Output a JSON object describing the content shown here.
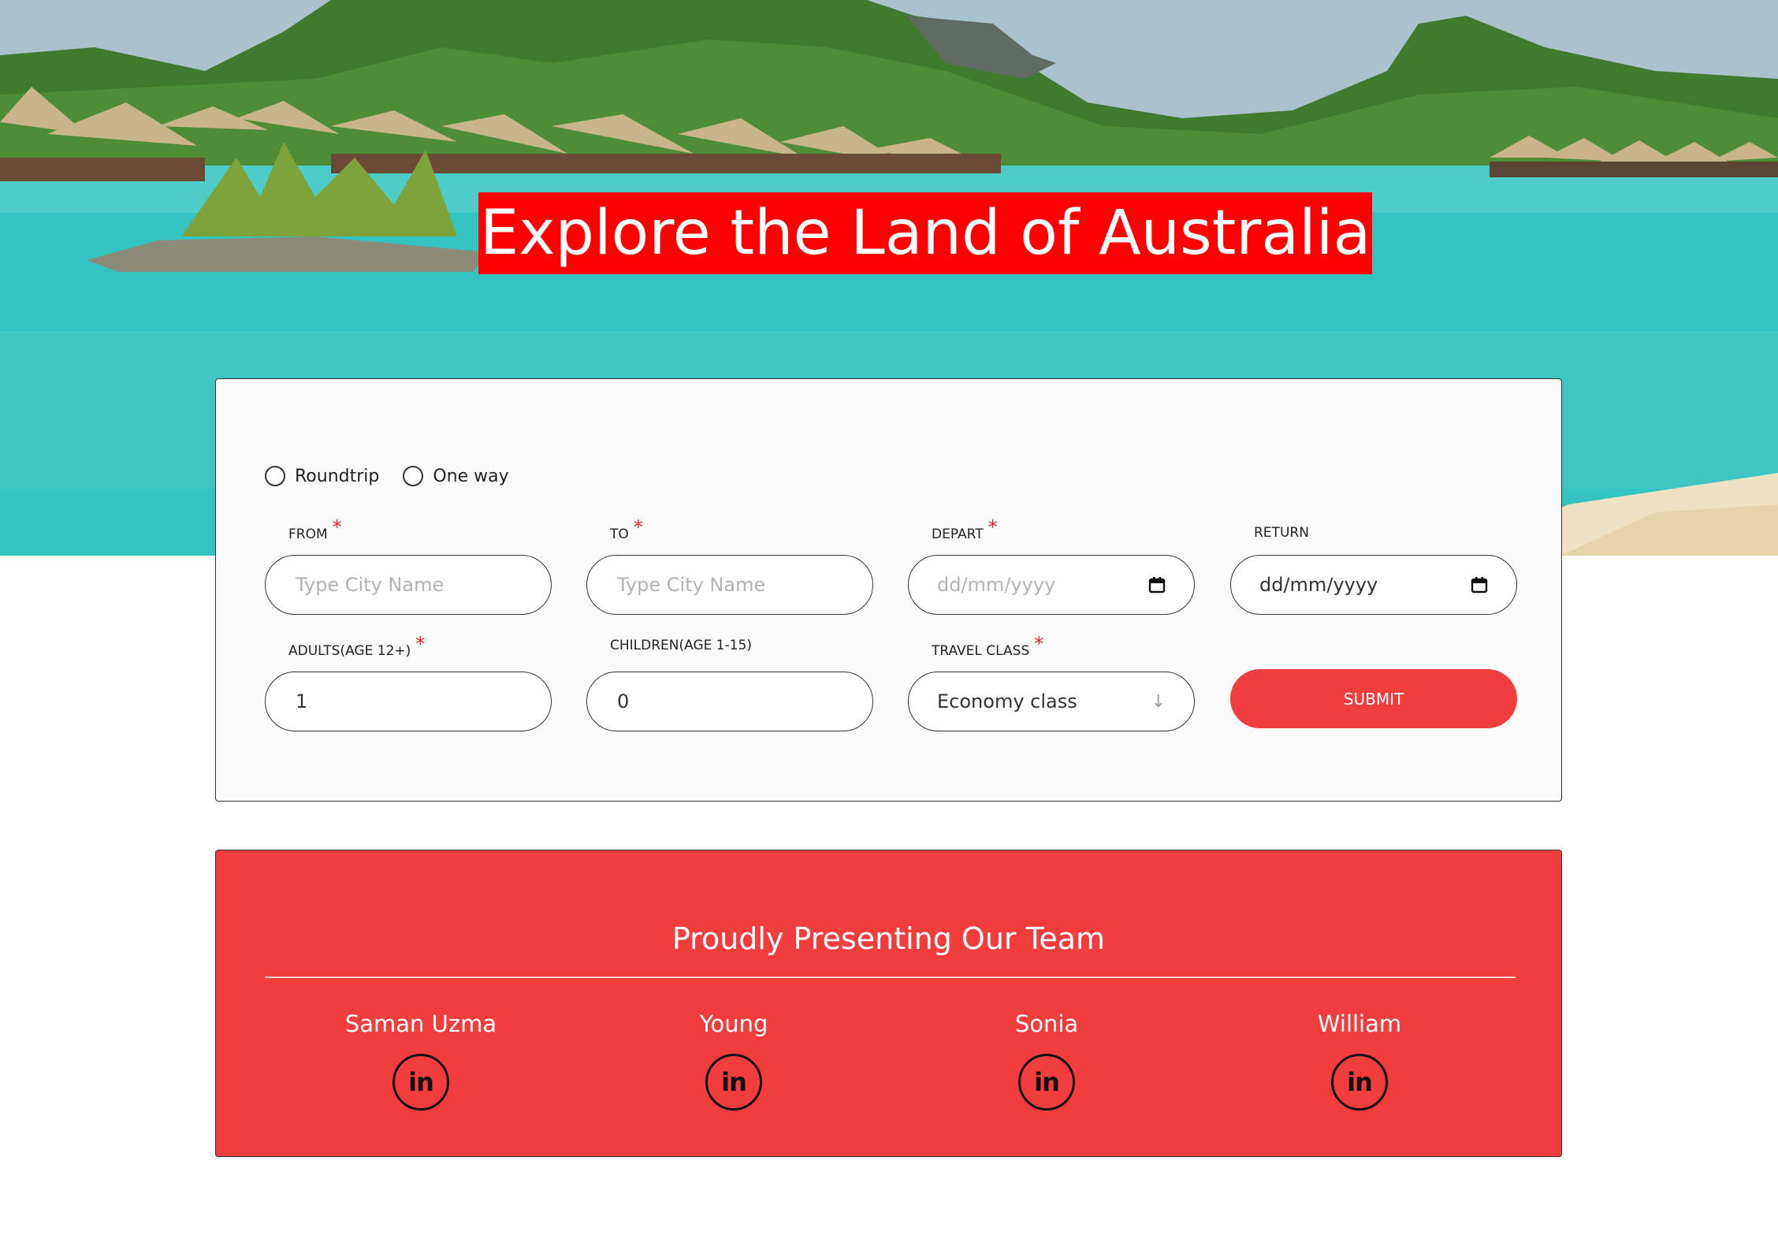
{
  "hero": {
    "title": "Explore the Land of Australia"
  },
  "booking": {
    "trip_types": [
      {
        "label": "Roundtrip"
      },
      {
        "label": "One way"
      }
    ],
    "from": {
      "label": "FROM",
      "placeholder": "Type City Name",
      "required": true
    },
    "to": {
      "label": "TO",
      "placeholder": "Type City Name",
      "required": true
    },
    "depart": {
      "label": "DEPART",
      "value": "dd/mm/yyyy",
      "required": true
    },
    "return": {
      "label": "RETURN",
      "value": "dd/mm/yyyy",
      "required": false
    },
    "adults": {
      "label": "ADULTS(AGE 12+)",
      "value": "1",
      "required": true
    },
    "children": {
      "label": "CHILDREN(AGE 1-15)",
      "value": "0",
      "required": false
    },
    "travel_class": {
      "label": "TRAVEL CLASS",
      "value": "Economy class",
      "arrow": "↓",
      "required": true
    },
    "submit_label": "SUBMIT",
    "required_mark": "*"
  },
  "team": {
    "heading": "Proudly Presenting Our Team",
    "linkedin_icon_text": "in",
    "members": [
      {
        "name": "Saman Uzma"
      },
      {
        "name": "Young"
      },
      {
        "name": "Sonia"
      },
      {
        "name": "William"
      }
    ]
  },
  "colors": {
    "accent": "#f23d3f",
    "title_bg": "#ff0000",
    "required": "#e51f2b"
  }
}
